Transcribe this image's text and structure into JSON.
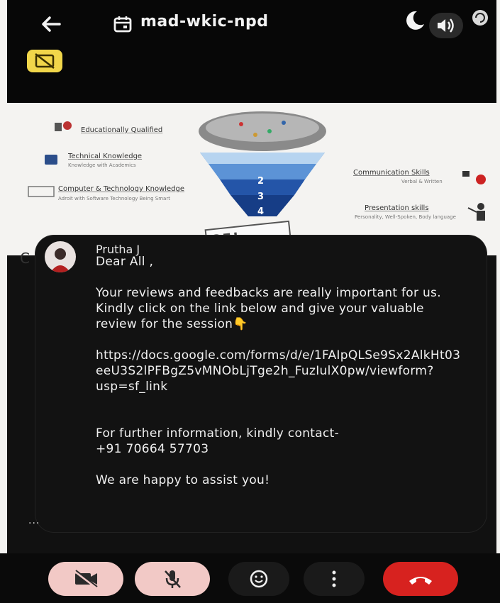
{
  "header": {
    "meeting_code": "mad-wkic-npd",
    "icons": [
      "back-arrow-icon",
      "calendar-icon",
      "moon-icon",
      "speaker-icon",
      "rotate-icon",
      "captions-off-icon"
    ]
  },
  "slide": {
    "left_items": [
      {
        "label": "Educationally Qualified",
        "sub": ""
      },
      {
        "label": "Technical Knowledge",
        "sub": "Knowledge with Academics"
      },
      {
        "label": "Computer & Technology Knowledge",
        "sub": "Adroit with Software Technology Being Smart"
      }
    ],
    "right_items": [
      {
        "label": "Communication Skills",
        "sub": "Verbal & Written"
      },
      {
        "label": "Presentation skills",
        "sub": "Personality, Well-Spoken, Body language"
      }
    ],
    "funnel_numbers": [
      "2",
      "3",
      "4"
    ],
    "note": "SEL"
  },
  "chat": {
    "sender": "Prutha J",
    "message": "Dear All ,\n\nYour reviews and feedbacks are really important for us. Kindly click on the link below and give your valuable review for the session👇\n\nhttps://docs.google.com/forms/d/e/1FAIpQLSe9Sx2AlkHt03eeU3S2lPFBgZ5vMNObLjTge2h_FuzIulX0pw/viewform?usp=sf_link\n\n\nFor further information, kindly contact-\n+91 70664 57703\n\nWe are happy to assist you!"
  },
  "left_edge": {
    "letter": "C",
    "dots": "..."
  },
  "controls": {
    "icons": [
      "camera-off-icon",
      "mic-off-icon",
      "emoji-icon",
      "more-vert-icon",
      "end-call-icon"
    ],
    "colors": {
      "muted_bg": "#f2c9c6",
      "end_call_bg": "#d7221f"
    }
  }
}
